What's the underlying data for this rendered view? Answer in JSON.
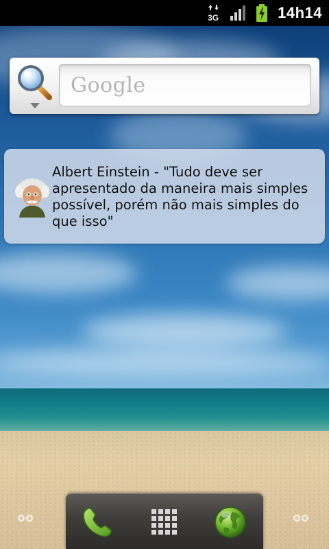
{
  "status_bar": {
    "network": "3G",
    "time": "14h14"
  },
  "search_widget": {
    "placeholder": "Google"
  },
  "quote_widget": {
    "text": "Albert Einstein - \"Tudo deve ser apresentado da maneira mais simples possível, porém não mais simples do que isso\""
  },
  "dock": {
    "items": [
      {
        "name": "phone",
        "icon": "phone-handset-icon"
      },
      {
        "name": "launcher",
        "icon": "app-grid-icon"
      },
      {
        "name": "browser",
        "icon": "globe-icon"
      }
    ]
  },
  "colors": {
    "status_bar_bg": "#000000",
    "dock_bg": "#3f3d3a",
    "quote_bg": "#ced8e8",
    "battery_green": "#8ccb2e"
  }
}
